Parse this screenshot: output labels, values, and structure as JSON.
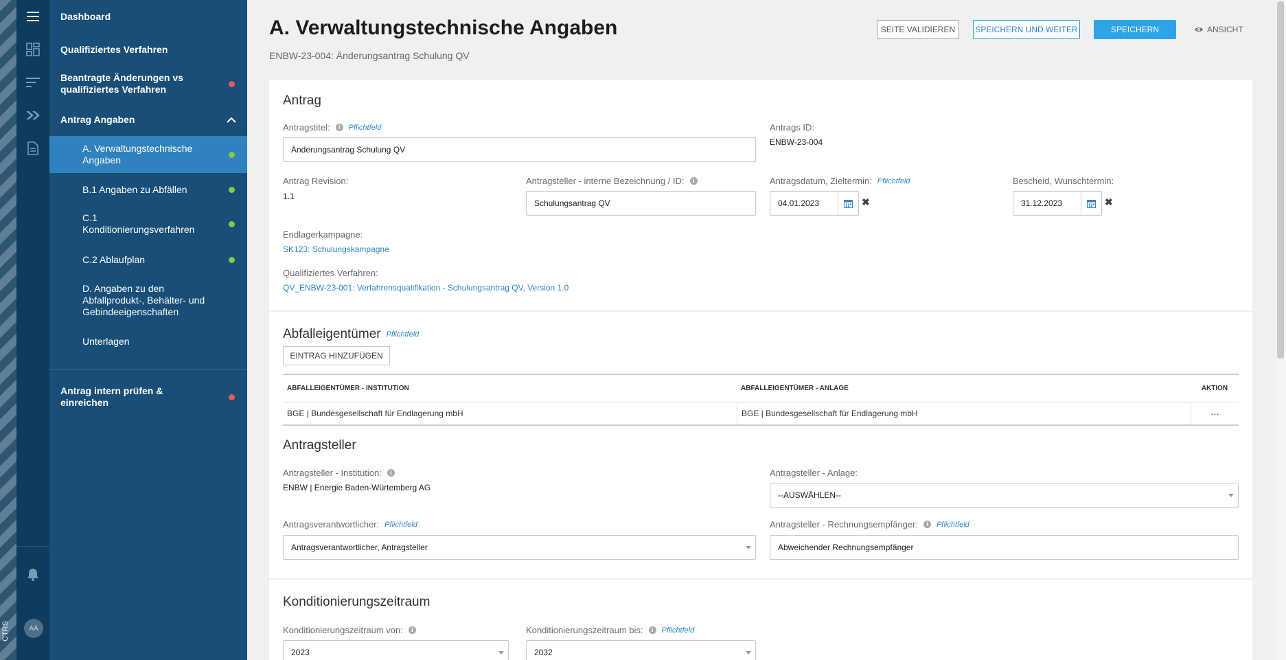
{
  "rail": {
    "side_label": "CTRS",
    "avatar_initials": "AA",
    "icons": [
      "menu-icon",
      "dashboard-icon",
      "sort-icon",
      "chevrons-right-icon",
      "document-icon",
      "bell-icon"
    ]
  },
  "nav": {
    "items": [
      {
        "label": "Dashboard"
      },
      {
        "label": "Qualifiziertes Verfahren"
      },
      {
        "label": "Beantragte Änderungen vs qualifiziertes Verfahren",
        "status": "red"
      },
      {
        "label": "Antrag Angaben",
        "expanded": true
      },
      {
        "label": "A. Verwaltungstechnische Angaben",
        "status": "green",
        "active": true
      },
      {
        "label": "B.1 Angaben zu Abfällen",
        "status": "green"
      },
      {
        "label": "C.1 Konditionierungsverfahren",
        "status": "green"
      },
      {
        "label": "C.2 Ablaufplan",
        "status": "green"
      },
      {
        "label": "D. Angaben zu den Abfallprodukt-, Behälter- und Gebindeeigenschaften"
      },
      {
        "label": "Unterlagen"
      },
      {
        "label": "Antrag intern prüfen & einreichen",
        "status": "red"
      }
    ]
  },
  "header": {
    "title": "A. Verwaltungstechnische Angaben",
    "subtitle": "ENBW-23-004: Änderungsantrag Schulung QV",
    "btn_validate": "SEITE VALIDIEREN",
    "btn_save_next": "SPEICHERN UND WEITER",
    "btn_save": "SPEICHERN",
    "btn_view": "ANSICHT"
  },
  "pflicht": "Pflichtfeld",
  "antrag": {
    "section_title": "Antrag",
    "titel_label": "Antragstitel:",
    "titel_value": "Änderungsantrag Schulung QV",
    "id_label": "Antrags ID:",
    "id_value": "ENBW-23-004",
    "revision_label": "Antrag Revision:",
    "revision_value": "1.1",
    "intern_label": "Antragsteller - interne Bezeichnung / ID:",
    "intern_value": "Schulungsantrag QV",
    "datum_label": "Antragsdatum, Zieltermin:",
    "datum_value": "04.01.2023",
    "bescheid_label": "Bescheid, Wunschtermin:",
    "bescheid_value": "31.12.2023",
    "kampagne_label": "Endlagerkampagne:",
    "kampagne_value": "SK123: Schulungskampagne",
    "verfahren_label": "Qualifiziertes Verfahren:",
    "verfahren_value": "QV_ENBW-23-001: Verfahrensqualifikation - Schulungsantrag QV, Version 1.0"
  },
  "abfall": {
    "section_title": "Abfalleigentümer",
    "add_button": "EINTRAG HINZUFÜGEN",
    "columns": [
      "ABFALLEIGENTÜMER - INSTITUTION",
      "ABFALLEIGENTÜMER - ANLAGE",
      "AKTION"
    ],
    "rows": [
      {
        "institution": "BGE | Bundesgesellschaft für Endlagerung mbH",
        "anlage": "BGE | Bundesgesellschaft für Endlagerung mbH",
        "aktion": "···"
      }
    ]
  },
  "antragsteller": {
    "section_title": "Antragsteller",
    "institution_label": "Antragsteller - Institution:",
    "institution_value": "ENBW | Energie Baden-Würtemberg AG",
    "anlage_label": "Antragsteller - Anlage:",
    "anlage_value": "--AUSWÄHLEN--",
    "verantwortlich_label": "Antragsverantwortlicher:",
    "verantwortlich_value": "Antragsverantwortlicher, Antragsteller",
    "rechnung_label": "Antragsteller - Rechnungsempfänger:",
    "rechnung_value": "Abweichender Rechnungsempfänger"
  },
  "kond": {
    "section_title": "Konditionierungszeitraum",
    "von_label": "Konditionierungszeitraum von:",
    "von_value": "2023",
    "bis_label": "Konditionierungszeitraum bis:",
    "bis_value": "2032"
  }
}
